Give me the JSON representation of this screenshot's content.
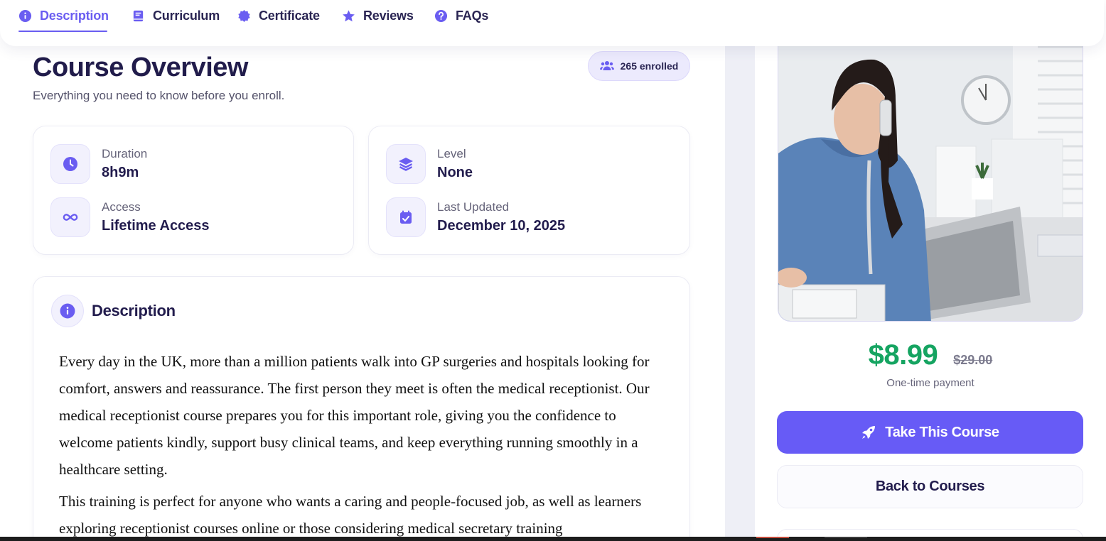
{
  "tabs": [
    {
      "label": "Description",
      "icon": "info-icon",
      "active": true
    },
    {
      "label": "Curriculum",
      "icon": "book-icon",
      "active": false
    },
    {
      "label": "Certificate",
      "icon": "certificate-icon",
      "active": false
    },
    {
      "label": "Reviews",
      "icon": "star-icon",
      "active": false
    },
    {
      "label": "FAQs",
      "icon": "question-icon",
      "active": false
    }
  ],
  "overview": {
    "title": "Course Overview",
    "subtitle": "Everything you need to know before you enroll.",
    "enrolled": "265 enrolled"
  },
  "stats": {
    "duration": {
      "label": "Duration",
      "value": "8h9m",
      "icon": "clock-icon"
    },
    "access": {
      "label": "Access",
      "value": "Lifetime Access",
      "icon": "infinity-icon"
    },
    "level": {
      "label": "Level",
      "value": "None",
      "icon": "layers-icon"
    },
    "updated": {
      "label": "Last Updated",
      "value": "December 10, 2025",
      "icon": "calendar-check-icon"
    }
  },
  "description": {
    "title": "Description",
    "paragraphs": [
      "Every day in the UK, more than a million patients walk into GP surgeries and hospitals looking for comfort, answers and reassurance. The first person they meet is often the medical receptionist. Our medical receptionist course prepares you for this important role, giving you the confidence to welcome patients kindly, support busy clinical teams, and keep everything running smoothly in a healthcare setting.",
      "This training is perfect for anyone who wants a caring and people-focused job, as well as learners exploring receptionist courses online or those considering medical secretary training"
    ]
  },
  "purchase": {
    "price": "$8.99",
    "old_price": "$29.00",
    "note": "One-time payment",
    "primary_label": "Take This Course",
    "secondary_label": "Back to Courses"
  },
  "colors": {
    "accent": "#675bf6",
    "price": "#15a461",
    "heading": "#221c4d"
  }
}
